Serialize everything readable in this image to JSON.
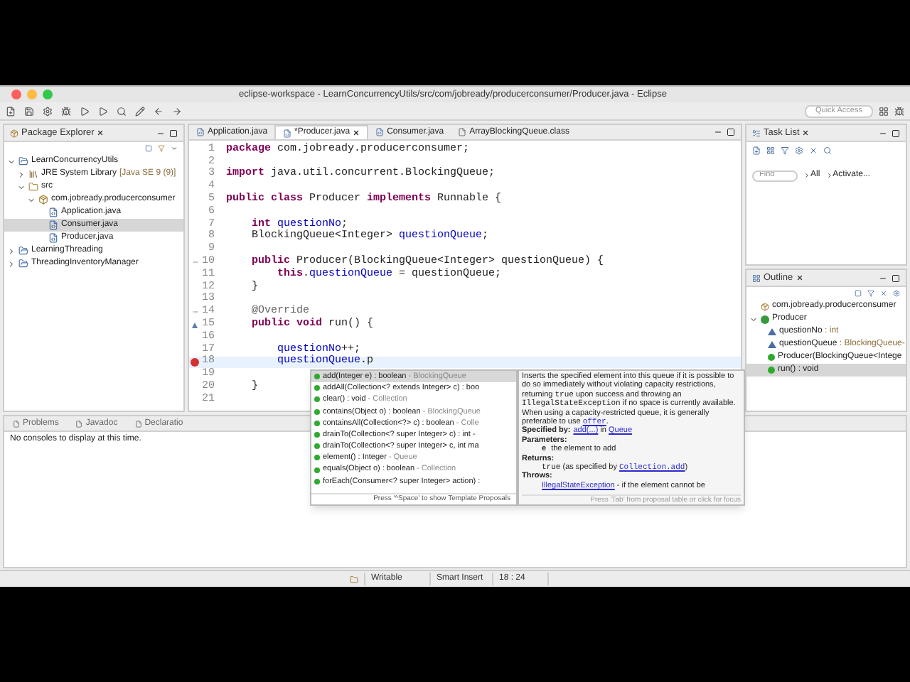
{
  "window": {
    "title": "eclipse-workspace - LearnConcurrencyUtils/src/com/jobready/producerconsumer/Producer.java - Eclipse"
  },
  "toolbar": {
    "quick_access": {
      "placeholder": "Quick Access"
    }
  },
  "package_explorer": {
    "title": "Package Explorer",
    "tree": [
      {
        "label": "LearnConcurrencyUtils",
        "kind": "project",
        "expanded": true,
        "selected": false,
        "children": [
          {
            "label": "JRE System Library",
            "decoration": "[Java SE 9 (9)]",
            "kind": "library",
            "expanded": false,
            "selected": false
          },
          {
            "label": "src",
            "kind": "folder",
            "expanded": true,
            "selected": false,
            "children": [
              {
                "label": "com.jobready.producerconsumer",
                "kind": "package",
                "expanded": true,
                "selected": false,
                "children": [
                  {
                    "label": "Application.java",
                    "kind": "file",
                    "expanded": false,
                    "selected": false
                  },
                  {
                    "label": "Consumer.java",
                    "kind": "file",
                    "expanded": false,
                    "selected": true
                  },
                  {
                    "label": "Producer.java",
                    "kind": "file",
                    "expanded": false,
                    "selected": false
                  }
                ]
              }
            ]
          }
        ]
      },
      {
        "label": "LearningThreading",
        "kind": "project",
        "expanded": false,
        "selected": false
      },
      {
        "label": "ThreadingInventoryManager",
        "kind": "project",
        "expanded": false,
        "selected": false
      }
    ]
  },
  "editor": {
    "tabs": [
      {
        "label": "Application.java",
        "kind": "java",
        "selected": false
      },
      {
        "label": "*Producer.java",
        "kind": "java",
        "selected": true
      },
      {
        "label": "Consumer.java",
        "kind": "java",
        "selected": false
      },
      {
        "label": "ArrayBlockingQueue.class",
        "kind": "class",
        "selected": false
      }
    ],
    "lines": [
      {
        "n": "1",
        "current": false,
        "segs": [
          {
            "t": "package",
            "kind": "keyword"
          },
          {
            "t": " com.jobready.producerconsumer;"
          }
        ]
      },
      {
        "n": "2",
        "current": false
      },
      {
        "n": "3",
        "current": false,
        "segs": [
          {
            "t": "import",
            "kind": "keyword"
          },
          {
            "t": " java.util.concurrent.BlockingQueue;"
          }
        ]
      },
      {
        "n": "4",
        "current": false
      },
      {
        "n": "5",
        "current": false,
        "segs": [
          {
            "t": "public class",
            "kind": "keyword"
          },
          {
            "t": " Producer "
          },
          {
            "t": "implements",
            "kind": "keyword"
          },
          {
            "t": " Runnable {"
          }
        ]
      },
      {
        "n": "6",
        "current": false
      },
      {
        "n": "7",
        "current": false,
        "segs": [
          {
            "t": "    int ",
            "kind": "keyword"
          },
          {
            "t": "questionNo",
            "kind": "field"
          },
          {
            "t": ";"
          }
        ]
      },
      {
        "n": "8",
        "current": false,
        "segs": [
          {
            "t": "    BlockingQueue<Integer> "
          },
          {
            "t": "questionQueue",
            "kind": "field"
          },
          {
            "t": ";"
          }
        ]
      },
      {
        "n": "9",
        "current": false
      },
      {
        "n": "10",
        "kind": "fold",
        "current": false,
        "segs": [
          {
            "t": "    public",
            "kind": "keyword"
          },
          {
            "t": " Producer(BlockingQueue<Integer> questionQueue) {"
          }
        ]
      },
      {
        "n": "11",
        "current": false,
        "segs": [
          {
            "t": "        this",
            "kind": "keyword"
          },
          {
            "t": "."
          },
          {
            "t": "questionQueue",
            "kind": "field"
          },
          {
            "t": " = questionQueue;"
          }
        ]
      },
      {
        "n": "12",
        "current": false,
        "segs": [
          {
            "t": "    }"
          }
        ]
      },
      {
        "n": "13",
        "current": false
      },
      {
        "n": "14",
        "kind": "fold",
        "current": false,
        "segs": [
          {
            "t": "    @Override",
            "kind": "annotation"
          }
        ]
      },
      {
        "n": "15",
        "kind": "override",
        "current": false,
        "segs": [
          {
            "t": "    public void",
            "kind": "keyword"
          },
          {
            "t": " run() {"
          }
        ]
      },
      {
        "n": "16",
        "current": false
      },
      {
        "n": "17",
        "current": false,
        "segs": [
          {
            "t": "        questionNo",
            "kind": "field"
          },
          {
            "t": "++;"
          }
        ]
      },
      {
        "n": "18",
        "kind": "error",
        "current": true,
        "segs": [
          {
            "t": "        questionQueue",
            "kind": "field"
          },
          {
            "t": ".p"
          }
        ]
      },
      {
        "n": "19",
        "current": false
      },
      {
        "n": "20",
        "current": false,
        "segs": [
          {
            "t": "    }"
          }
        ]
      },
      {
        "n": "21",
        "current": false
      }
    ]
  },
  "content_assist": {
    "proposals": [
      {
        "name": "add(Integer e) : boolean",
        "detail": "- BlockingQueue",
        "selected": true
      },
      {
        "name": "addAll(Collection<? extends Integer> c) : boo",
        "selected": false
      },
      {
        "name": "clear() : void",
        "detail": "- Collection",
        "selected": false
      },
      {
        "name": "contains(Object o) : boolean",
        "detail": "- BlockingQueue",
        "selected": false
      },
      {
        "name": "containsAll(Collection<?> c) : boolean",
        "detail": "- Colle",
        "selected": false
      },
      {
        "name": "drainTo(Collection<? super Integer> c) : int -",
        "selected": false
      },
      {
        "name": "drainTo(Collection<? super Integer> c, int ma",
        "selected": false
      },
      {
        "name": "element() : Integer",
        "detail": "- Queue",
        "selected": false
      },
      {
        "name": "equals(Object o) : boolean",
        "detail": "- Collection",
        "selected": false
      },
      {
        "name": "forEach(Consumer<? super Integer> action) :",
        "selected": false
      }
    ],
    "proposals_hint": "Press '^Space' to show Template Proposals",
    "doc": [
      {
        "kind": "para",
        "segs": [
          {
            "t": "Inserts the specified element into this queue if it is possible to do so immediately without violating capacity restrictions, returning "
          },
          {
            "t": "true",
            "kind": "code"
          },
          {
            "t": " upon success and throwing an "
          },
          {
            "t": "IllegalStateException",
            "kind": "code"
          },
          {
            "t": " if no space is currently available. When using a capacity-restricted queue, it is generally preferable to use "
          },
          {
            "t": "offer",
            "kind": "codelink"
          },
          {
            "t": "."
          }
        ]
      },
      {
        "kind": "para",
        "segs": [
          {
            "t": "Specified by:",
            "kind": "bold"
          },
          {
            "t": "add(...)",
            "kind": "link"
          },
          {
            "t": " in "
          },
          {
            "t": "Queue",
            "kind": "link"
          }
        ]
      },
      {
        "kind": "heading",
        "segs": [
          {
            "t": "Parameters:"
          }
        ]
      },
      {
        "kind": "indent",
        "segs": [
          {
            "t": "e",
            "kind": "bold"
          },
          {
            "t": " the element to add"
          }
        ]
      },
      {
        "kind": "heading",
        "segs": [
          {
            "t": "Returns:"
          }
        ]
      },
      {
        "kind": "indent",
        "segs": [
          {
            "t": "true",
            "kind": "code"
          },
          {
            "t": " (as specified by "
          },
          {
            "t": "Collection.add",
            "kind": "codelink"
          },
          {
            "t": ")"
          }
        ]
      },
      {
        "kind": "heading",
        "segs": [
          {
            "t": "Throws:"
          }
        ]
      },
      {
        "kind": "indent",
        "segs": [
          {
            "t": "IllegalStateException",
            "kind": "link"
          },
          {
            "t": " - if the element cannot be"
          }
        ]
      }
    ],
    "doc_hint": "Press 'Tab' from proposal table or click for focus"
  },
  "task_list": {
    "title": "Task List",
    "find": {
      "placeholder": "Find"
    },
    "filters": [
      "All",
      "Activate..."
    ]
  },
  "outline": {
    "title": "Outline",
    "tree": [
      {
        "label": "com.jobready.producerconsumer",
        "kind": "package",
        "selected": false
      },
      {
        "label": "Producer",
        "kind": "class",
        "expanded": true,
        "selected": false,
        "children": [
          {
            "label": "questionNo",
            "type": " : int",
            "kind": "field",
            "selected": false
          },
          {
            "label": "questionQueue",
            "type": " : BlockingQueue-",
            "kind": "field",
            "selected": false
          },
          {
            "label": "Producer(BlockingQueue<Intege",
            "kind": "constructor",
            "selected": false
          },
          {
            "label": "run() : void",
            "kind": "method",
            "selected": true
          }
        ]
      }
    ]
  },
  "bottom_panel": {
    "tabs": [
      {
        "label": "Problems",
        "selected": false
      },
      {
        "label": "Javadoc",
        "selected": false
      },
      {
        "label": "Declaratio",
        "selected": false
      }
    ],
    "message": "No consoles to display at this time."
  },
  "status_bar": {
    "mode": "Writable",
    "insert": "Smart Insert",
    "position": "18 : 24"
  }
}
